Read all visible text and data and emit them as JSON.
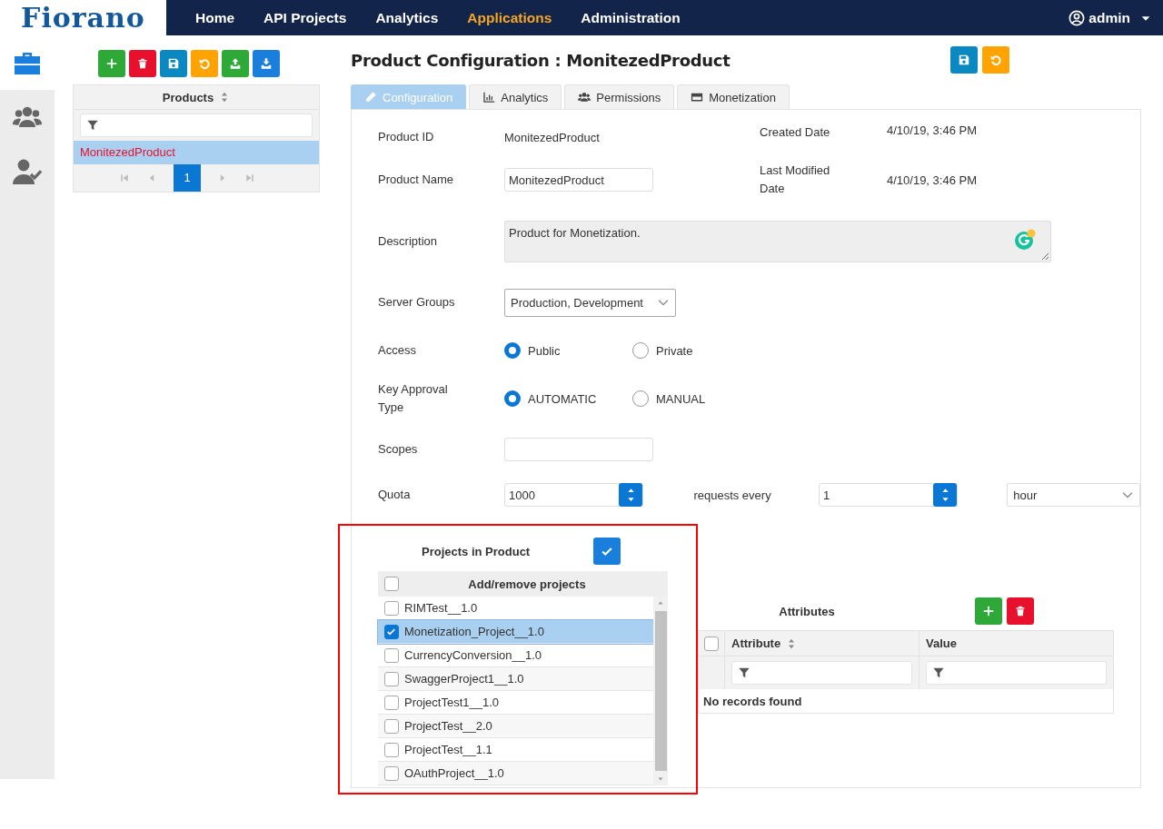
{
  "logo": "Fiorano",
  "nav": [
    {
      "label": "Home",
      "selected": false
    },
    {
      "label": "API Projects",
      "selected": false
    },
    {
      "label": "Analytics",
      "selected": false
    },
    {
      "label": "Applications",
      "selected": true
    },
    {
      "label": "Administration",
      "selected": false
    }
  ],
  "user": "admin",
  "rail": [
    {
      "kind": "briefcase",
      "selected": true
    },
    {
      "kind": "users",
      "selected": false
    },
    {
      "kind": "user-check",
      "selected": false
    }
  ],
  "products": {
    "toolbar": [
      {
        "kind": "add"
      },
      {
        "kind": "delete"
      },
      {
        "kind": "save"
      },
      {
        "kind": "reset"
      },
      {
        "kind": "import"
      },
      {
        "kind": "export"
      }
    ],
    "column": "Products",
    "rows": [
      {
        "name": "MonitezedProduct",
        "selected": true
      }
    ],
    "pages": [
      {
        "label": "1",
        "selected": true
      }
    ]
  },
  "title": "Product Configuration : MonitezedProduct",
  "title_actions": [
    {
      "kind": "save"
    },
    {
      "kind": "reset"
    }
  ],
  "tabs": [
    {
      "label": "Configuration",
      "kind": "edit",
      "selected": true
    },
    {
      "label": "Analytics",
      "kind": "chart",
      "selected": false
    },
    {
      "label": "Permissions",
      "kind": "users",
      "selected": false
    },
    {
      "label": "Monetization",
      "kind": "card",
      "selected": false
    }
  ],
  "product_id": {
    "label": "Product ID",
    "value": "MonitezedProduct"
  },
  "created_date": {
    "label": "Created Date",
    "value": "4/10/19, 3:46 PM"
  },
  "product_name": {
    "label": "Product Name",
    "value": "MonitezedProduct"
  },
  "last_modified": {
    "label": "Last Modified Date",
    "value": "4/10/19, 3:46 PM"
  },
  "description": {
    "label": "Description",
    "value": "Product for Monetization."
  },
  "server_groups": {
    "label": "Server Groups",
    "value": "Production, Development"
  },
  "access": {
    "label": "Access",
    "options": [
      {
        "label": "Public",
        "selected": true
      },
      {
        "label": "Private",
        "selected": false
      }
    ]
  },
  "key_approval": {
    "label": "Key Approval Type",
    "options": [
      {
        "label": "AUTOMATIC",
        "selected": true
      },
      {
        "label": "MANUAL",
        "selected": false
      }
    ]
  },
  "scopes": {
    "label": "Scopes"
  },
  "quota": {
    "label": "Quota",
    "value": "1000",
    "per_label": "requests every",
    "interval": "1",
    "unit": "hour"
  },
  "projects": {
    "title": "Projects in Product",
    "column": "Add/remove projects",
    "all_checked": false,
    "items": [
      {
        "name": "RIMTest__1.0",
        "checked": false,
        "selected": false
      },
      {
        "name": "Monetization_Project__1.0",
        "checked": true,
        "selected": true
      },
      {
        "name": "CurrencyConversion__1.0",
        "checked": false,
        "selected": false
      },
      {
        "name": "SwaggerProject1__1.0",
        "checked": false,
        "selected": false
      },
      {
        "name": "ProjectTest1__1.0",
        "checked": false,
        "selected": false
      },
      {
        "name": "ProjectTest__2.0",
        "checked": false,
        "selected": false
      },
      {
        "name": "ProjectTest__1.1",
        "checked": false,
        "selected": false
      },
      {
        "name": "OAuthProject__1.0",
        "checked": false,
        "selected": false
      }
    ]
  },
  "attributes": {
    "title": "Attributes",
    "actions": [
      {
        "kind": "add"
      },
      {
        "kind": "delete"
      }
    ],
    "all_checked": false,
    "columns": [
      "Attribute",
      "Value"
    ],
    "empty": "No records found"
  }
}
